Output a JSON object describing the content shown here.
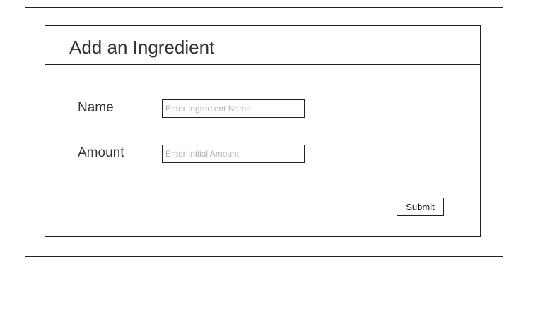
{
  "dialog": {
    "title": "Add an Ingredient"
  },
  "form": {
    "name": {
      "label": "Name",
      "value": "",
      "placeholder": "Enter Ingredient Name"
    },
    "amount": {
      "label": "Amount",
      "value": "",
      "placeholder": "Enter Initial Amount"
    },
    "submit_label": "Submit"
  }
}
